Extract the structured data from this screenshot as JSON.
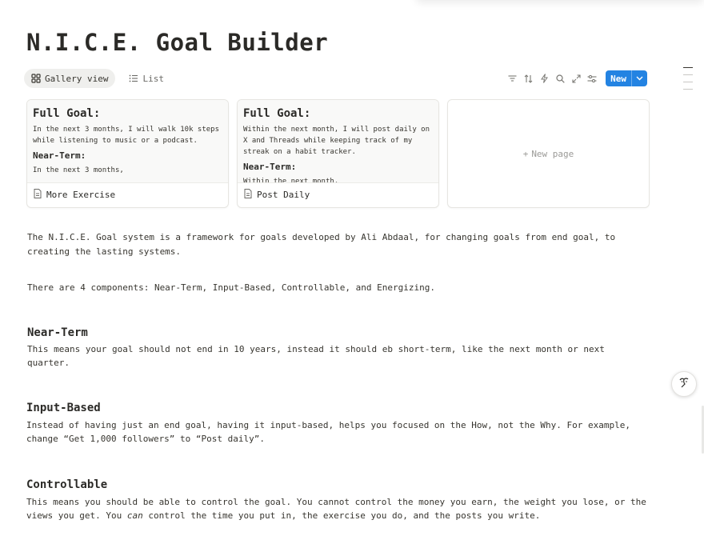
{
  "page": {
    "title": "N.I.C.E. Goal Builder"
  },
  "views": {
    "gallery_label": "Gallery view",
    "list_label": "List"
  },
  "toolbar": {
    "icons": [
      "filter-icon",
      "sort-icon",
      "automation-icon",
      "search-icon",
      "expand-icon",
      "settings-icon"
    ],
    "new_label": "New"
  },
  "gallery": {
    "cards": [
      {
        "heading": "Full Goal:",
        "text": "In the next 3 months, I will walk 10k steps while listening to music or a podcast.",
        "subheading": "Near-Term:",
        "subtext": "In the next 3 months,",
        "title": "More Exercise"
      },
      {
        "heading": "Full Goal:",
        "text": "Within the next month, I will post daily on X and Threads while keeping track of my streak on a habit tracker.",
        "subheading": "Near-Term:",
        "subtext": "Within the next month,",
        "title": "Post Daily"
      }
    ],
    "new_page_label": "New page"
  },
  "content": {
    "intro": "The N.I.C.E. Goal system is a framework for goals developed by Ali Abdaal, for changing goals from end goal, to creating the lasting systems.",
    "components": "There are 4 components: Near-Term, Input-Based, Controllable, and Energizing.",
    "near_term_heading": "Near-Term",
    "near_term_text": "This means your goal should not end in 10 years, instead it should eb short-term, like the next month or next quarter.",
    "input_heading": "Input-Based",
    "input_text": "Instead of having just an end goal, having it input-based, helps you focused on the How, not the Why. For example, change “Get 1,000 followers” to “Post daily”.",
    "controllable_heading": "Controllable",
    "controllable_text_1": "This means you should be able to control the goal. You cannot control the money you earn, the weight you lose, or the views you get. You ",
    "controllable_text_em": "can",
    "controllable_text_2": " control the time you put in, the exercise you do, and the posts you write."
  },
  "colors": {
    "accent": "#2383e2",
    "text": "#37352f",
    "muted": "#9b9a97"
  }
}
